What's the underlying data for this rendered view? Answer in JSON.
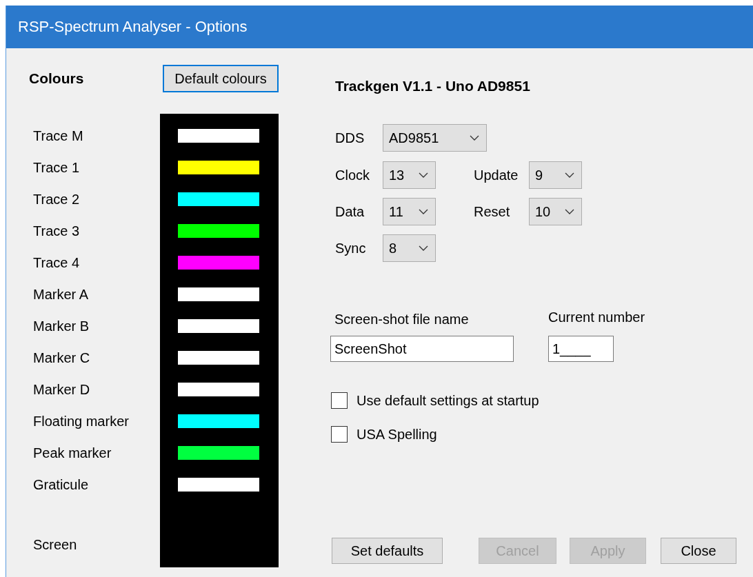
{
  "window": {
    "title": "RSP-Spectrum Analyser - Options"
  },
  "colours": {
    "heading": "Colours",
    "default_button": "Default colours",
    "rows": [
      {
        "label": "Trace M",
        "color": "#ffffff"
      },
      {
        "label": "Trace 1",
        "color": "#ffff00"
      },
      {
        "label": "Trace 2",
        "color": "#00ffff"
      },
      {
        "label": "Trace 3",
        "color": "#00ff00"
      },
      {
        "label": "Trace 4",
        "color": "#ff00ff"
      },
      {
        "label": "Marker A",
        "color": "#ffffff"
      },
      {
        "label": "Marker B",
        "color": "#ffffff"
      },
      {
        "label": "Marker C",
        "color": "#ffffff"
      },
      {
        "label": "Marker D",
        "color": "#ffffff"
      },
      {
        "label": "Floating marker",
        "color": "#00ffff"
      },
      {
        "label": "Peak marker",
        "color": "#00ff40"
      },
      {
        "label": "Graticule",
        "color": "#ffffff"
      }
    ],
    "screen_label": "Screen"
  },
  "device_title": "Trackgen V1.1 - Uno AD9851",
  "dds": {
    "label": "DDS",
    "value": "AD9851"
  },
  "pins_left": [
    {
      "label": "Clock",
      "value": "13"
    },
    {
      "label": "Data",
      "value": "11"
    },
    {
      "label": "Sync",
      "value": "8"
    }
  ],
  "pins_right": [
    {
      "label": "Update",
      "value": "9"
    },
    {
      "label": "Reset",
      "value": "10"
    }
  ],
  "screenshot_name": {
    "label": "Screen-shot file name",
    "value": "ScreenShot"
  },
  "current_number": {
    "label": "Current number",
    "value": "1____"
  },
  "checkboxes": [
    {
      "label": "Use default settings at startup",
      "checked": false
    },
    {
      "label": "USA Spelling",
      "checked": false
    }
  ],
  "buttons": [
    {
      "label": "Set defaults",
      "disabled": false
    },
    {
      "label": "Cancel",
      "disabled": true
    },
    {
      "label": "Apply",
      "disabled": true
    },
    {
      "label": "Close",
      "disabled": false
    }
  ]
}
